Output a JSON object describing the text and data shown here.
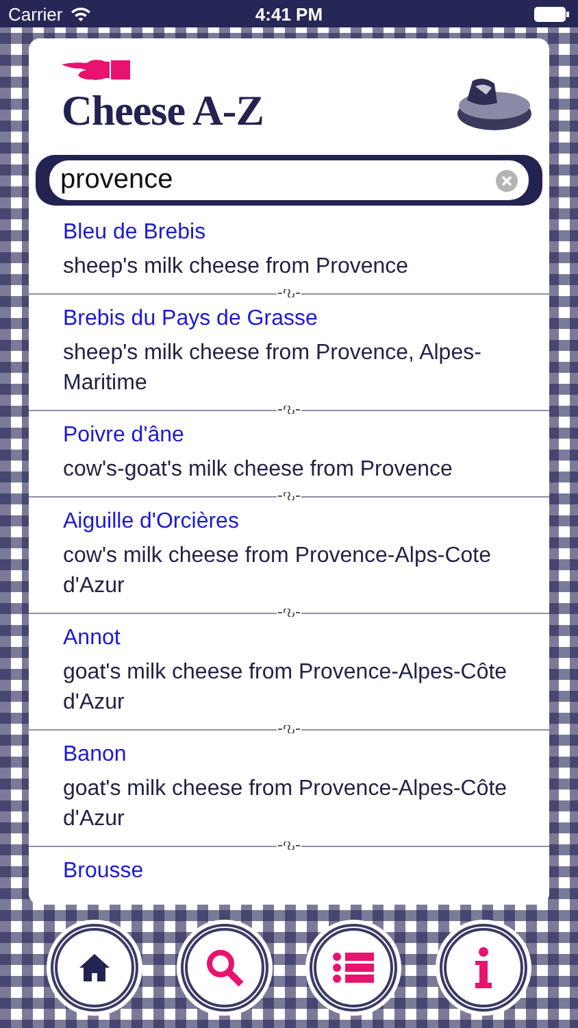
{
  "status_bar": {
    "carrier": "Carrier",
    "time": "4:41 PM"
  },
  "header": {
    "title": "Cheese A-Z"
  },
  "search": {
    "value": "provence"
  },
  "results": [
    {
      "name": "Bleu de Brebis",
      "description": "sheep's milk cheese from Provence"
    },
    {
      "name": "Brebis du Pays de Grasse",
      "description": "sheep's milk cheese from Provence, Alpes-Maritime"
    },
    {
      "name": "Poivre d'âne",
      "description": "cow's-goat's milk cheese from Provence"
    },
    {
      "name": "Aiguille d'Orcières",
      "description": "cow's milk cheese from Provence-Alps-Cote d'Azur"
    },
    {
      "name": "Annot",
      "description": "goat's milk cheese from Provence-Alpes-Côte d'Azur"
    },
    {
      "name": "Banon",
      "description": "goat's milk cheese from  Provence-Alpes-Côte d'Azur"
    },
    {
      "name": "Brousse"
    }
  ],
  "tab_bar": [
    {
      "kind": "home"
    },
    {
      "kind": "search"
    },
    {
      "kind": "list"
    },
    {
      "kind": "info"
    }
  ]
}
